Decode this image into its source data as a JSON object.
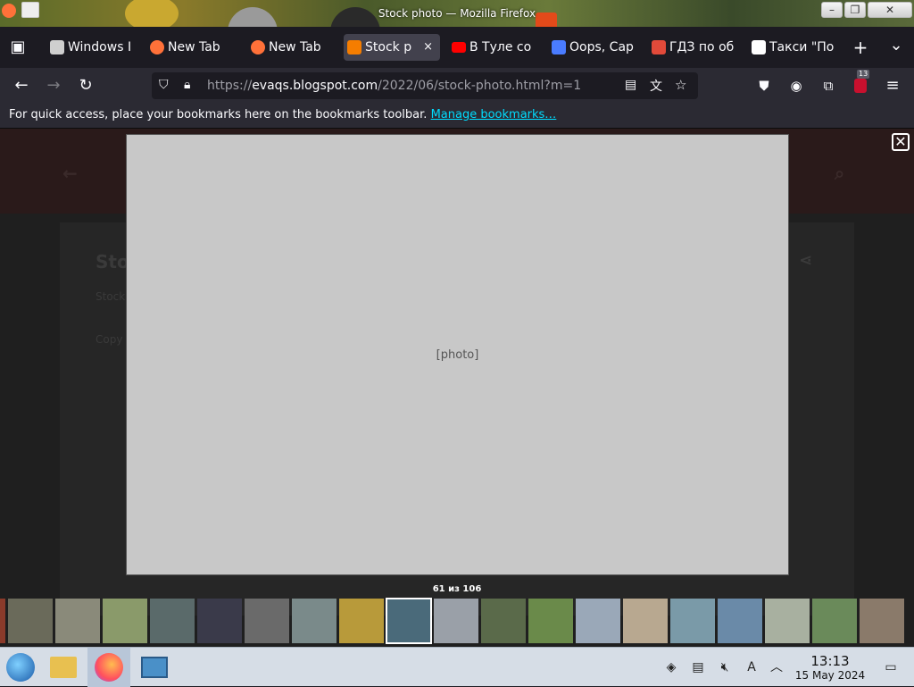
{
  "window": {
    "title": "Stock photo — Mozilla Firefox",
    "minimize": "–",
    "maximize": "❐",
    "close": "✕"
  },
  "tabs": [
    {
      "label": "Windows I",
      "icon_color": "#cfcfcf"
    },
    {
      "label": "New Tab",
      "icon_color": "#ff7139"
    },
    {
      "label": "New Tab",
      "icon_color": "#ff7139"
    },
    {
      "label": "Stock p",
      "icon_color": "#f57d00",
      "active": true
    },
    {
      "label": "В Туле со",
      "icon_color": "#ff0000"
    },
    {
      "label": "Oops, Сар",
      "icon_color": "#4a7cff"
    },
    {
      "label": "ГДЗ по об",
      "icon_color": "#e24a3a"
    },
    {
      "label": "Такси \"По",
      "icon_color": "#ffffff"
    }
  ],
  "tabs_meta": {
    "new_tab": "+",
    "list_all": "⌄",
    "tab_close": "×"
  },
  "nav": {
    "back": "←",
    "forward": "→",
    "reload": "↻",
    "url_base": "https://",
    "url_host": "evaqs.blogspot.com",
    "url_path": "/2022/06/stock-photo.html?m=1",
    "extension_badge": "13"
  },
  "bookmarks": {
    "message": "For quick access, place your bookmarks here on the bookmarks toolbar.",
    "link": "Manage bookmarks…"
  },
  "background_page": {
    "title": "Sto",
    "line1": "Stock",
    "line2": "Сору"
  },
  "lightbox": {
    "close": "✕",
    "counter": "61 из 106",
    "current_index": 61,
    "total": 106
  },
  "thumbnails": [
    {
      "color": "#8a3a2a"
    },
    {
      "color": "#6a6a5a"
    },
    {
      "color": "#8a8a7a"
    },
    {
      "color": "#8a9a6a"
    },
    {
      "color": "#5a6a6a"
    },
    {
      "color": "#3a3a4a"
    },
    {
      "color": "#6a6a6a"
    },
    {
      "color": "#7a8a8a"
    },
    {
      "color": "#b89a3a"
    },
    {
      "color": "#4a6a7a"
    },
    {
      "color": "#9aa0a8"
    },
    {
      "color": "#5a6a4a"
    },
    {
      "color": "#6a8a4a"
    },
    {
      "color": "#9aa8b8"
    },
    {
      "color": "#b8a890"
    },
    {
      "color": "#7a9aa8"
    },
    {
      "color": "#6a8aa8"
    },
    {
      "color": "#a8b0a0"
    },
    {
      "color": "#6a8a5a"
    },
    {
      "color": "#8a7a6a"
    }
  ],
  "taskbar": {
    "time": "13:13",
    "date": "15 May 2024"
  }
}
